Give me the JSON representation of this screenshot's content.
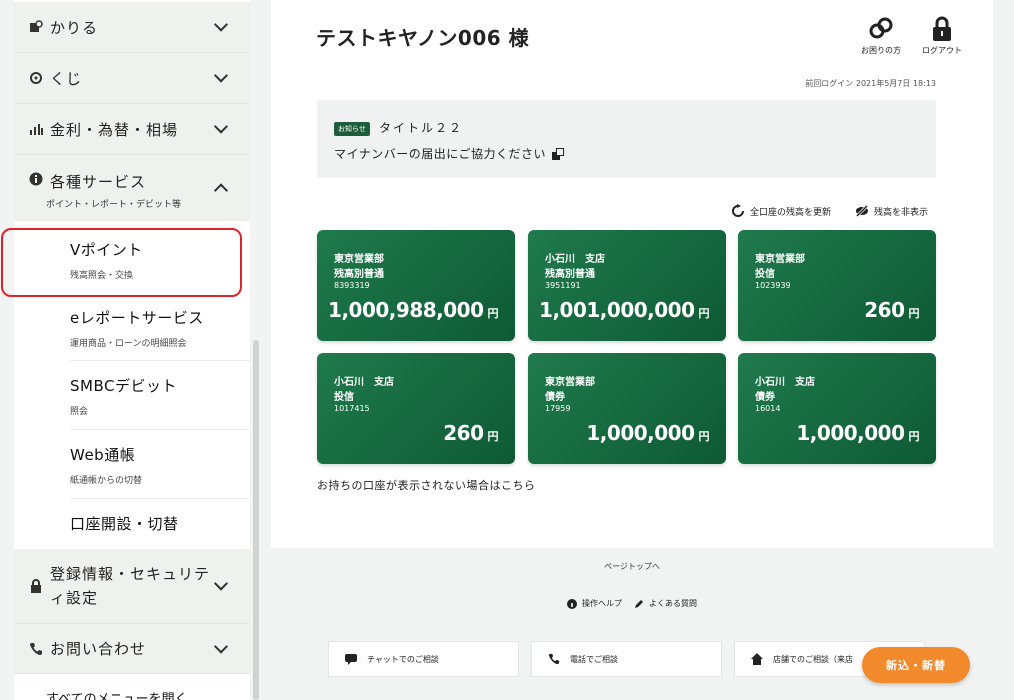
{
  "sidebar": {
    "sections": [
      {
        "label": "かりる",
        "icon": "borrow-icon"
      },
      {
        "label": "くじ",
        "icon": "lottery-icon"
      },
      {
        "label": "金利・為替・相場",
        "icon": "chart-icon"
      },
      {
        "label": "各種サービス",
        "icon": "info-icon",
        "sub": "ポイント・レポート・デビット等"
      }
    ],
    "items": [
      {
        "label": "Vポイント",
        "desc": "残高照会・交換"
      },
      {
        "label": "eレポートサービス",
        "desc": "運用商品・ローンの明細照会"
      },
      {
        "label": "SMBCデビット",
        "desc": "照会"
      },
      {
        "label": "Web通帳",
        "desc": "紙通帳からの切替"
      },
      {
        "label": "口座開設・切替",
        "desc": ""
      }
    ],
    "security": {
      "label_line1": "登録情報・セキュリテ",
      "label_line2": "ィ設定"
    },
    "contact": {
      "label": "お問い合わせ"
    },
    "all_menu": "すべてのメニューを開く"
  },
  "header": {
    "username": "テストキヤノン006 様",
    "help_label": "お困りの方",
    "logout_label": "ログアウト",
    "last_login": "前回ログイン 2021年5月7日 18:13"
  },
  "notice": {
    "badge": "お知らせ",
    "title": "タイトル２２",
    "message": "マイナンバーの届出にご協力ください"
  },
  "actions": {
    "refresh": "全口座の残高を更新",
    "hide": "残高を非表示"
  },
  "accounts": [
    {
      "branch": "東京営業部",
      "type": "残高別普通",
      "number": "8393319",
      "amount": "1,000,988,000",
      "unit": "円"
    },
    {
      "branch": "小石川　支店",
      "type": "残高別普通",
      "number": "3951191",
      "amount": "1,001,000,000",
      "unit": "円"
    },
    {
      "branch": "東京営業部",
      "type": "投信",
      "number": "1023939",
      "amount": "260",
      "unit": "円"
    },
    {
      "branch": "小石川　支店",
      "type": "投信",
      "number": "1017415",
      "amount": "260",
      "unit": "円"
    },
    {
      "branch": "東京営業部",
      "type": "債券",
      "number": "17959",
      "amount": "1,000,000",
      "unit": "円"
    },
    {
      "branch": "小石川　支店",
      "type": "債券",
      "number": "16014",
      "amount": "1,000,000",
      "unit": "円"
    }
  ],
  "not_shown_link": "お持ちの口座が表示されない場合はこちら",
  "footer": {
    "page_top": "ページトップへ",
    "help": "操作ヘルプ",
    "faq": "よくある質問",
    "chat": "チャットでのご相談",
    "phone": "電話でご相談",
    "branch": "店舗でのご相談（来店"
  },
  "fab": "新込・新替",
  "colors": {
    "brand_green": "#1e5d3b",
    "accent_orange": "#f2892a",
    "highlight_red": "#e2222b"
  }
}
